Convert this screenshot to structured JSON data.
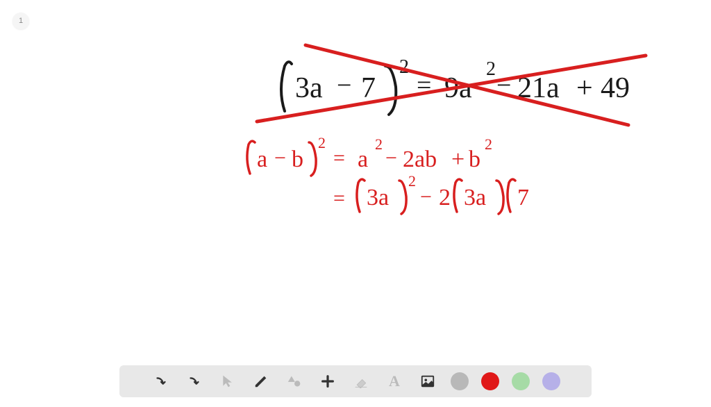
{
  "page": {
    "number": "1"
  },
  "equations": {
    "line1": "(3a − 7)² = 9a² − 21a + 49",
    "line2": "(a − b)² = a² − 2ab + b²",
    "line3": "= (3a)² − 2(3a)(7"
  },
  "strikethrough": {
    "present": true,
    "color": "#d81f1f"
  },
  "toolbar": {
    "tools": [
      {
        "name": "undo",
        "icon": "↶"
      },
      {
        "name": "redo",
        "icon": "↷"
      },
      {
        "name": "select",
        "icon": "➤"
      },
      {
        "name": "pen",
        "icon": "✎"
      },
      {
        "name": "shapes",
        "icon": "◆"
      },
      {
        "name": "plus",
        "icon": "+"
      },
      {
        "name": "eraser",
        "icon": "◢"
      },
      {
        "name": "text",
        "icon": "A"
      },
      {
        "name": "image",
        "icon": "🖼"
      }
    ],
    "colors": [
      {
        "name": "gray",
        "hex": "#b8b8b8"
      },
      {
        "name": "red",
        "hex": "#e01818"
      },
      {
        "name": "green",
        "hex": "#a6dba6"
      },
      {
        "name": "purple",
        "hex": "#b6b0e8"
      }
    ]
  }
}
